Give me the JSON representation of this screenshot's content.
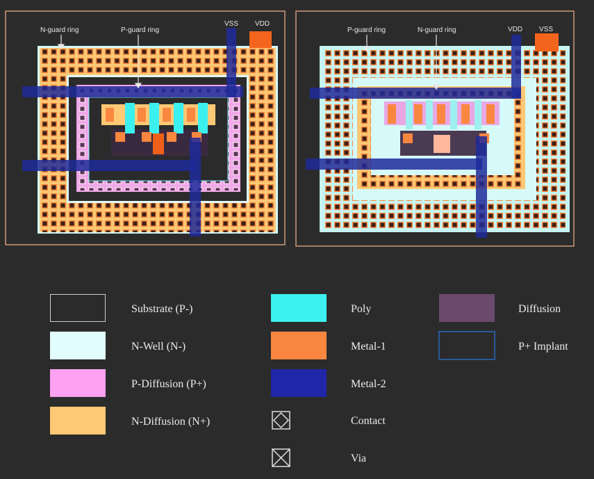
{
  "left_layout": {
    "labels": {
      "n_guard": "N-guard ring",
      "p_guard": "P-guard ring",
      "vss": "VSS",
      "vdd": "VDD"
    }
  },
  "right_layout": {
    "labels": {
      "p_guard": "P-guard ring",
      "n_guard": "N-guard ring",
      "vdd": "VDD",
      "vss": "VSS"
    }
  },
  "legend": [
    {
      "id": "substrate",
      "label": "Substrate (P-)",
      "color": "#2b2b2b",
      "border": "#cfcfcf"
    },
    {
      "id": "nwell",
      "label": "N-Well (N-)",
      "color": "#e2fdfd",
      "border": "#e2fdfd"
    },
    {
      "id": "pdiff",
      "label": "P-Diffusion (P+)",
      "color": "#ffa0f0",
      "border": "#ffa0f0"
    },
    {
      "id": "ndiff",
      "label": "N-Diffusion (N+)",
      "color": "#ffc874",
      "border": "#ffc874"
    },
    {
      "id": "poly",
      "label": "Poly",
      "color": "#3cf0f0",
      "border": "#3cf0f0"
    },
    {
      "id": "metal1",
      "label": "Metal-1",
      "color": "#f98740",
      "border": "#f98740"
    },
    {
      "id": "metal2",
      "label": "Metal-2",
      "color": "#2026a8",
      "border": "#2026a8"
    },
    {
      "id": "contact",
      "label": "Contact",
      "icon": "contact-icon"
    },
    {
      "id": "via",
      "label": "Via",
      "icon": "via-icon"
    },
    {
      "id": "diffusion",
      "label": "Diffusion",
      "color": "#6b4a6e",
      "border": "#6b4a6e"
    },
    {
      "id": "pimplant",
      "label": "P+ Implant",
      "color": "#2b2b2b",
      "border": "#2a5a9a"
    }
  ]
}
